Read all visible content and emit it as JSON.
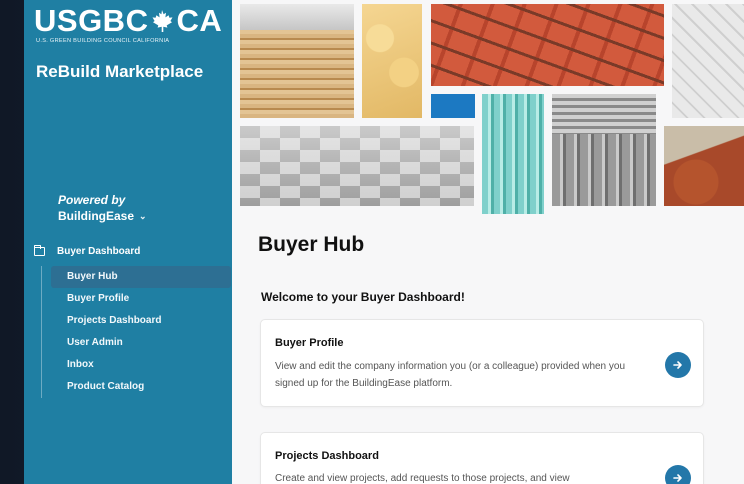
{
  "sidebar": {
    "logo_text_left": "USGBC",
    "logo_text_right": "CA",
    "logo_subtitle": "U.S. GREEN BUILDING COUNCIL CALIFORNIA",
    "app_title": "ReBuild Marketplace",
    "powered_by": "Powered by",
    "brand": "BuildingEase",
    "nav_header": "Buyer Dashboard",
    "items": [
      {
        "label": "Buyer Hub",
        "active": true
      },
      {
        "label": "Buyer Profile"
      },
      {
        "label": "Projects Dashboard"
      },
      {
        "label": "User Admin"
      },
      {
        "label": "Inbox"
      },
      {
        "label": "Product Catalog"
      }
    ]
  },
  "icons": {
    "logo": "maple-leaf-icon",
    "brand_dropdown": "chevron-down-icon",
    "nav_header": "folder-icon",
    "card_action": "arrow-right-icon"
  },
  "colors": {
    "sidebar": "#1f7fa3",
    "active_item": "#2d6f93",
    "accent_button": "#2377a9"
  },
  "main": {
    "title": "Buyer Hub",
    "welcome": "Welcome to your Buyer Dashboard!",
    "cards": [
      {
        "title": "Buyer Profile",
        "description": "View and edit the company information you (or a colleague) provided when you signed up for the BuildingEase platform."
      },
      {
        "title": "Projects Dashboard",
        "description": "Create and view projects, add requests to those projects, and view"
      }
    ]
  }
}
